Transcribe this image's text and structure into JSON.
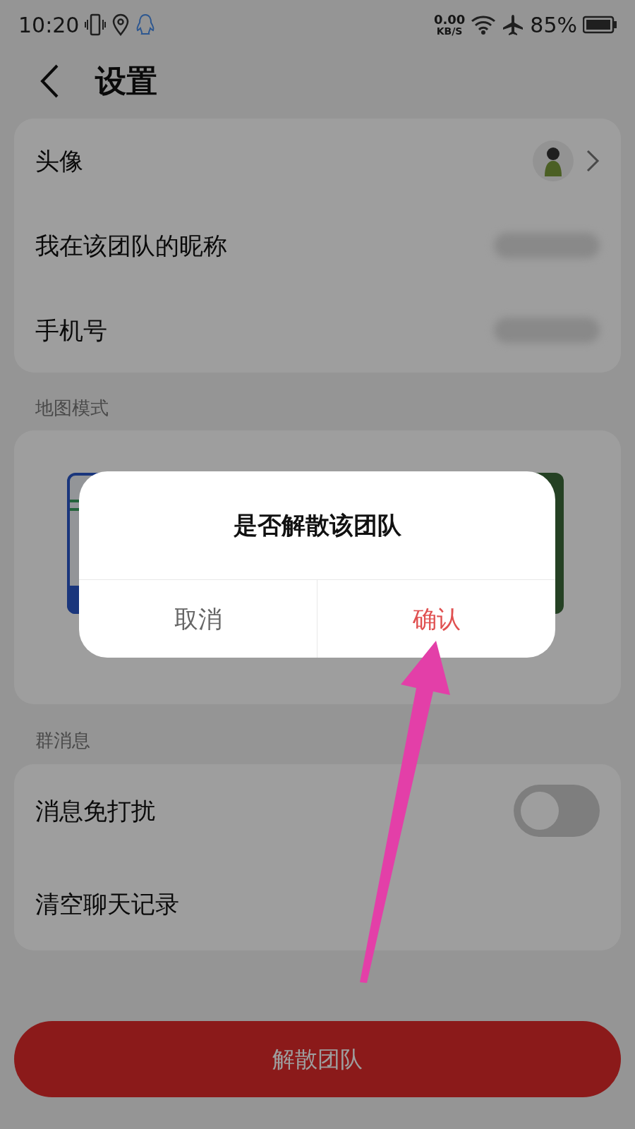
{
  "status_bar": {
    "time": "10:20",
    "speed_value": "0.00",
    "speed_unit": "KB/S",
    "battery": "85%"
  },
  "header": {
    "title": "设置"
  },
  "profile_rows": [
    {
      "label": "头像",
      "kind": "avatar"
    },
    {
      "label": "我在该团队的昵称",
      "kind": "blurred"
    },
    {
      "label": "手机号",
      "kind": "blurred"
    }
  ],
  "map_section": {
    "label": "地图模式",
    "maps": [
      {
        "kind": "standard",
        "selected": true
      },
      {
        "kind": "satellite",
        "selected": false
      }
    ]
  },
  "message_section": {
    "label": "群消息",
    "rows": [
      {
        "label": "消息免打扰",
        "kind": "toggle",
        "on": false
      },
      {
        "label": "清空聊天记录",
        "kind": "plain"
      }
    ]
  },
  "disband_button": {
    "label": "解散团队"
  },
  "dialog": {
    "title": "是否解散该团队",
    "buttons": [
      {
        "label": "取消",
        "kind": "cancel"
      },
      {
        "label": "确认",
        "kind": "confirm"
      }
    ]
  }
}
